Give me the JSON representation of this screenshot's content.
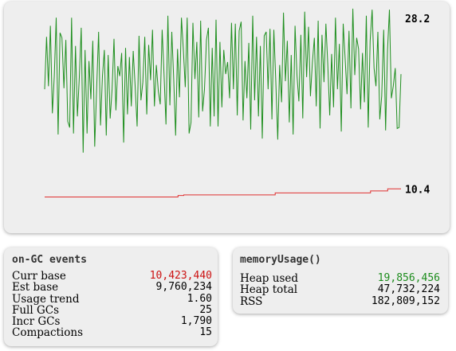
{
  "chart_data": {
    "type": "line",
    "series": [
      {
        "end_label": "28.2",
        "color": "#1f8f1f",
        "values": [
          20.3,
          25.5,
          20.6,
          26.6,
          17.9,
          21.6,
          27.4,
          15.8,
          25.9,
          25.4,
          20.4,
          25.2,
          17.1,
          16.5,
          27.4,
          15.9,
          24.6,
          17.6,
          21.5,
          26.4,
          14.0,
          24.2,
          15.9,
          23.1,
          19.3,
          25.1,
          14.6,
          20.3,
          26.0,
          16.7,
          21.6,
          24.2,
          15.7,
          23.7,
          17.4,
          20.3,
          25.3,
          18.2,
          22.6,
          21.6,
          23.9,
          15.0,
          24.4,
          17.8,
          23.5,
          18.6,
          24.1,
          20.5,
          16.6,
          25.6,
          19.2,
          21.0,
          25.5,
          17.8,
          24.7,
          21.2,
          26.2,
          18.6,
          22.7,
          20.1,
          18.8,
          26.2,
          21.7,
          16.8,
          27.6,
          18.7,
          26.0,
          21.3,
          15.7,
          24.3,
          19.5,
          27.4,
          24.2,
          20.5,
          27.4,
          15.9,
          17.0,
          26.9,
          21.3,
          25.0,
          17.5,
          27.1,
          18.1,
          20.3,
          25.2,
          26.4,
          16.6,
          24.4,
          17.6,
          27.2,
          16.6,
          25.0,
          18.5,
          24.2,
          21.8,
          23.0,
          19.4,
          26.9,
          20.3,
          26.8,
          17.7,
          26.1,
          27.0,
          17.2,
          23.1,
          19.4,
          24.9,
          16.3,
          27.6,
          19.2,
          25.5,
          17.6,
          24.6,
          15.4,
          25.6,
          26.0,
          20.3,
          26.3,
          17.3,
          26.2,
          21.2,
          15.3,
          22.7,
          19.0,
          27.9,
          21.1,
          25.1,
          17.0,
          23.7,
          15.8,
          26.6,
          21.7,
          19.1,
          25.7,
          17.4,
          28.0,
          21.5,
          26.5,
          19.6,
          23.0,
          25.4,
          18.6,
          27.1,
          16.4,
          25.7,
          21.0,
          26.8,
          22.7,
          17.7,
          23.8,
          18.5,
          27.4,
          20.3,
          24.8,
          16.1,
          26.8,
          23.4,
          19.8,
          26.1,
          18.4,
          28.3,
          21.7,
          25.4,
          24.3,
          18.3,
          23.9,
          19.0,
          27.6,
          16.5,
          25.1,
          28.2,
          22.4,
          20.6,
          26.0,
          17.3,
          19.6,
          26.2,
          16.2,
          24.2,
          28.2,
          19.4,
          20.6,
          22.4,
          16.4,
          16.5,
          21.8
        ]
      },
      {
        "end_label": "10.4",
        "color": "#e03030",
        "values": [
          9.6,
          9.6,
          9.6,
          9.6,
          9.6,
          9.6,
          9.6,
          9.6,
          9.6,
          9.6,
          9.6,
          9.6,
          9.6,
          9.6,
          9.6,
          9.6,
          9.6,
          9.6,
          9.6,
          9.6,
          9.6,
          9.6,
          9.6,
          9.6,
          9.6,
          9.6,
          9.6,
          9.6,
          9.6,
          9.6,
          9.6,
          9.6,
          9.6,
          9.6,
          9.6,
          9.6,
          9.6,
          9.6,
          9.6,
          9.6,
          9.6,
          9.6,
          9.6,
          9.6,
          9.6,
          9.6,
          9.6,
          9.6,
          9.6,
          9.6,
          9.6,
          9.6,
          9.6,
          9.6,
          9.6,
          9.6,
          9.6,
          9.6,
          9.6,
          9.6,
          9.6,
          9.6,
          9.6,
          9.6,
          9.6,
          9.6,
          9.6,
          9.6,
          9.6,
          9.6,
          9.75,
          9.75,
          9.75,
          9.8,
          9.8,
          9.8,
          9.8,
          9.8,
          9.8,
          9.8,
          9.8,
          9.8,
          9.8,
          9.8,
          9.8,
          9.8,
          9.8,
          9.8,
          9.8,
          9.8,
          9.8,
          9.8,
          9.8,
          9.8,
          9.8,
          9.8,
          9.8,
          9.8,
          9.8,
          9.8,
          9.8,
          9.8,
          9.8,
          9.8,
          9.8,
          9.8,
          9.8,
          9.8,
          9.8,
          9.8,
          9.8,
          9.8,
          9.8,
          9.8,
          9.8,
          9.8,
          9.8,
          9.8,
          9.8,
          9.8,
          9.8,
          10.0,
          10.0,
          10.0,
          10.0,
          10.0,
          10.0,
          10.0,
          10.0,
          10.0,
          10.0,
          10.0,
          10.0,
          10.0,
          10.0,
          10.0,
          10.0,
          10.0,
          10.0,
          10.0,
          10.0,
          10.0,
          10.0,
          10.0,
          10.0,
          10.0,
          10.0,
          10.0,
          10.0,
          10.0,
          10.0,
          10.0,
          10.0,
          10.0,
          10.0,
          10.0,
          10.0,
          10.0,
          10.0,
          10.0,
          10.0,
          10.0,
          10.0,
          10.0,
          10.0,
          10.0,
          10.0,
          10.0,
          10.0,
          10.0,
          10.0,
          10.2,
          10.2,
          10.2,
          10.2,
          10.2,
          10.2,
          10.2,
          10.2,
          10.2,
          10.4,
          10.4,
          10.4,
          10.4,
          10.4,
          10.4,
          10.4,
          10.4
        ]
      }
    ],
    "ylim": [
      6.0,
      29.0
    ]
  },
  "gc_events": {
    "title": "on-GC events",
    "highlight_color": "#cc1111",
    "rows": [
      {
        "label": "Curr base",
        "value": "10,423,440",
        "highlight": true
      },
      {
        "label": "Est base",
        "value": "9,760,234"
      },
      {
        "label": "Usage trend",
        "value": "1.60"
      },
      {
        "label": "Full GCs",
        "value": "25"
      },
      {
        "label": "Incr GCs",
        "value": "1,790"
      },
      {
        "label": "Compactions",
        "value": "15"
      }
    ]
  },
  "memory_usage": {
    "title": "memoryUsage()",
    "highlight_color": "#1c8c1c",
    "rows": [
      {
        "label": "Heap used",
        "value": "19,856,456",
        "highlight": true
      },
      {
        "label": "Heap total",
        "value": "47,732,224"
      },
      {
        "label": "RSS",
        "value": "182,809,152"
      }
    ]
  }
}
